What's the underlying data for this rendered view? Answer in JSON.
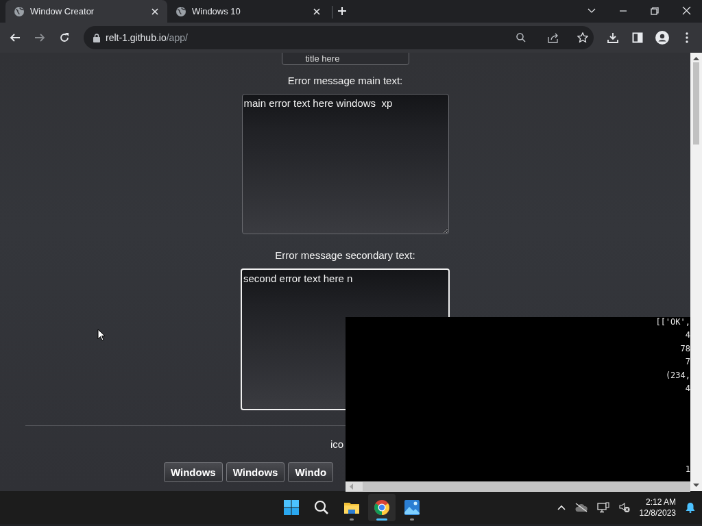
{
  "browser": {
    "tabs": [
      {
        "title": "Window Creator",
        "selected": true
      },
      {
        "title": "Windows 10",
        "selected": false
      }
    ],
    "url_host": "relt-1.github.io",
    "url_path": "/app/"
  },
  "page": {
    "title_field": {
      "value": "title here"
    },
    "main_text_label": "Error message main text:",
    "main_text_field": {
      "value": "main error text here windows  xp",
      "focused": false
    },
    "secondary_text_label": "Error message secondary text:",
    "secondary_text_field": {
      "value": "second error text here n",
      "focused": true
    },
    "icon_label": "ico",
    "style_buttons": [
      "Windows",
      "Windows",
      "Windo"
    ]
  },
  "console": {
    "lines": [
      "[['OK',",
      "4",
      "78",
      "7",
      "(234,",
      "4",
      "1"
    ]
  },
  "taskbar": {
    "apps": [
      {
        "kind": "start",
        "running": false,
        "selected": false
      },
      {
        "kind": "search",
        "running": false,
        "selected": false
      },
      {
        "kind": "files",
        "running": true,
        "selected": false
      },
      {
        "kind": "chrome",
        "running": true,
        "selected": true
      },
      {
        "kind": "photos",
        "running": true,
        "selected": false
      }
    ],
    "time": "2:12 AM",
    "date": "12/8/2023"
  }
}
